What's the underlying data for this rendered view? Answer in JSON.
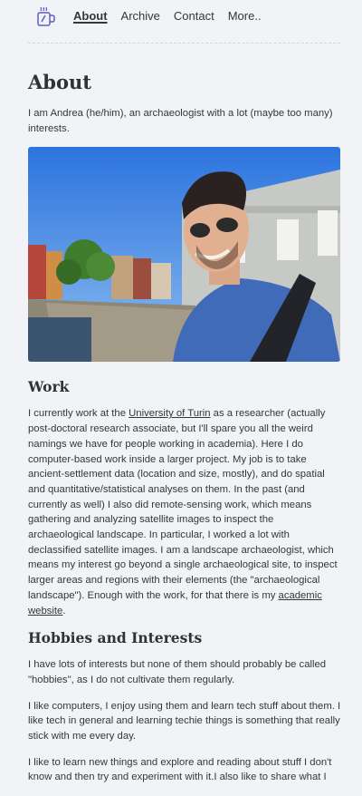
{
  "nav": {
    "logo_icon": "mug-icon",
    "links": [
      {
        "label": "About",
        "active": true
      },
      {
        "label": "Archive"
      },
      {
        "label": "Contact"
      },
      {
        "label": "More.."
      }
    ]
  },
  "page": {
    "title": "About",
    "intro": "I am Andrea (he/him), an archaeologist with a lot (maybe too many) interests.",
    "photo_icon": "profile-photo",
    "work": {
      "heading": "Work",
      "p1_before": "I currently work at the ",
      "p1_link": "University of Turin",
      "p1_mid": " as a researcher (actually post-doctoral research associate, but I'll spare you all the weird namings we have for people working in academia). Here I do computer-based work inside a larger project. My job is to take ancient-settlement data (location and size, mostly), and do spatial and quantitative/statistical analyses on them. In the past (and currently as well) I also did remote-sensing work, which means gathering and analyzing satellite images to inspect the archaeological landscape. In particular, I worked a lot with declassified satellite images. I am a landscape archaeologist, which means my interest go beyond a single archaeological site, to inspect larger areas and regions with their elements (the \"archaeological landscape\"). Enough with the work, for that there is my ",
      "p1_link2": "academic website",
      "p1_end": "."
    },
    "hobbies": {
      "heading": "Hobbies and Interests",
      "p1": "I have lots of interests but none of them should probably be called \"hobbies\", as I do not cultivate them regularly.",
      "p2": "I like computers, I enjoy using them and learn tech stuff about them. I like tech in general and learning techie things is something that really stick with me every day.",
      "p3": "I like to learn new things and explore and reading about stuff I don't know and then try and experiment with it.I also like to share what I"
    }
  }
}
